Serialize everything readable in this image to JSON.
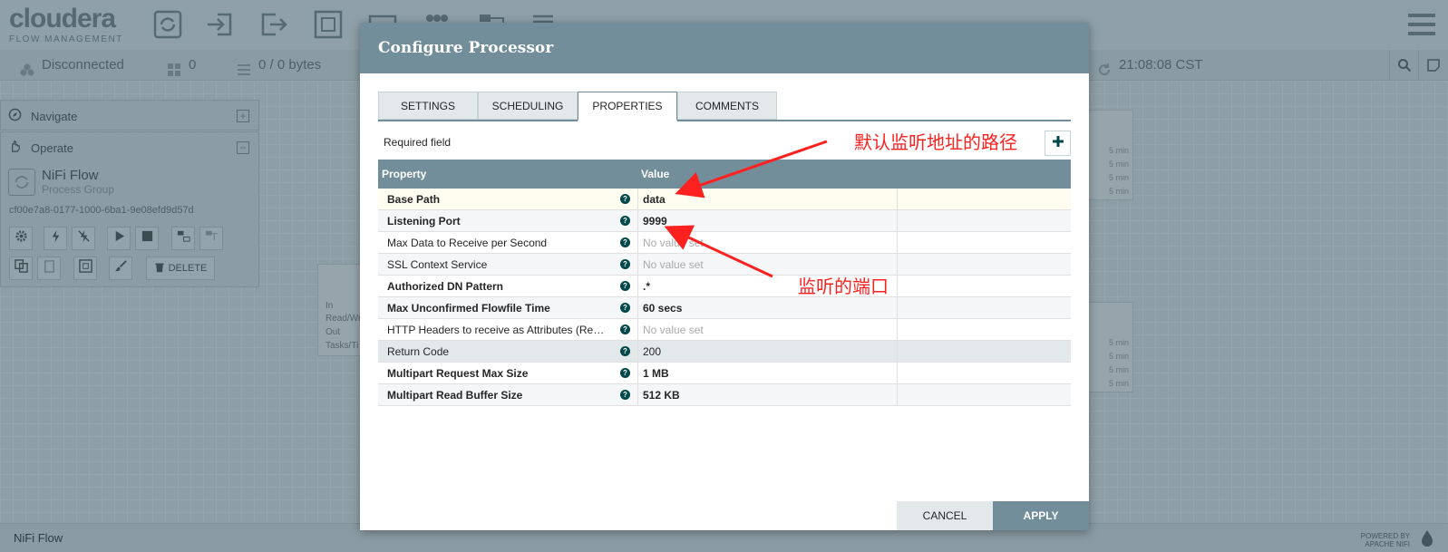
{
  "header": {
    "brand": "cloudera",
    "brand_sub": "FLOW MANAGEMENT",
    "toolbar_icons": [
      "processor-icon",
      "input-port-icon",
      "output-port-icon",
      "process-group-icon",
      "remote-process-group-icon",
      "funnel-icon",
      "template-icon",
      "label-icon"
    ],
    "menu_icon": "hamburger-icon"
  },
  "status": {
    "connection": "Disconnected",
    "threads": "0",
    "queued": "0 / 0 bytes",
    "time": "21:08:08 CST"
  },
  "palette": {
    "navigate_label": "Navigate",
    "operate_label": "Operate",
    "flow_name": "NiFi Flow",
    "flow_type": "Process Group",
    "flow_id": "cf00e7a8-0177-1000-6ba1-9e08efd9d57d",
    "delete_label": "DELETE"
  },
  "canvas": {
    "stat_labels": [
      "In",
      "Read/Wr",
      "Out",
      "Tasks/Ti"
    ],
    "mini_value": "5 min"
  },
  "footer": {
    "breadcrumb": "NiFi Flow",
    "powered_line1": "POWERED BY",
    "powered_line2": "APACHE NIFI"
  },
  "dialog": {
    "title": "Configure Processor",
    "tabs": [
      {
        "label": "SETTINGS"
      },
      {
        "label": "SCHEDULING"
      },
      {
        "label": "PROPERTIES"
      },
      {
        "label": "COMMENTS"
      }
    ],
    "required_label": "Required field",
    "columns": {
      "property": "Property",
      "value": "Value"
    },
    "rows": [
      {
        "name": "Base Path",
        "value": "data"
      },
      {
        "name": "Listening Port",
        "value": "9999"
      },
      {
        "name": "Max Data to Receive per Second",
        "value": "No value set"
      },
      {
        "name": "SSL Context Service",
        "value": "No value set"
      },
      {
        "name": "Authorized DN Pattern",
        "value": ".*"
      },
      {
        "name": "Max Unconfirmed Flowfile Time",
        "value": "60 secs"
      },
      {
        "name": "HTTP Headers to receive as Attributes (Reg...",
        "value": "No value set"
      },
      {
        "name": "Return Code",
        "value": "200"
      },
      {
        "name": "Multipart Request Max Size",
        "value": "1 MB"
      },
      {
        "name": "Multipart Read Buffer Size",
        "value": "512 KB"
      }
    ],
    "cancel_label": "CANCEL",
    "apply_label": "APPLY"
  },
  "annotations": {
    "base_path_note": "默认监听地址的路径",
    "port_note": "监听的端口",
    "color": "#ff2020"
  },
  "colors": {
    "dialog_header": "#728e9b",
    "help_icon": "#004849",
    "overlay": "#8e9ea6"
  }
}
